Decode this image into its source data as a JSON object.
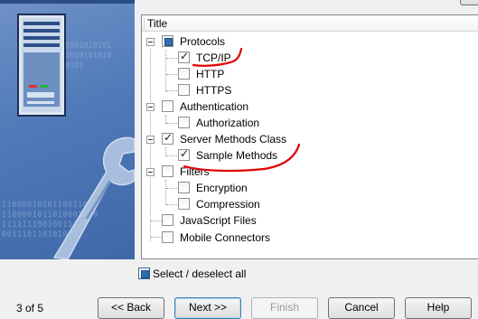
{
  "tree": {
    "header": "Title",
    "nodes": [
      {
        "label": "Protocols",
        "state": "partial"
      },
      {
        "label": "TCP/IP",
        "state": "checked"
      },
      {
        "label": "HTTP",
        "state": "unchecked"
      },
      {
        "label": "HTTPS",
        "state": "unchecked"
      },
      {
        "label": "Authentication",
        "state": "unchecked"
      },
      {
        "label": "Authorization",
        "state": "unchecked"
      },
      {
        "label": "Server Methods Class",
        "state": "checked"
      },
      {
        "label": "Sample Methods",
        "state": "checked"
      },
      {
        "label": "Filters",
        "state": "unchecked"
      },
      {
        "label": "Encryption",
        "state": "unchecked"
      },
      {
        "label": "Compression",
        "state": "unchecked"
      },
      {
        "label": "JavaScript Files",
        "state": "unchecked"
      },
      {
        "label": "Mobile Connectors",
        "state": "unchecked"
      }
    ]
  },
  "select_all": {
    "label": "Select / deselect all",
    "state": "partial"
  },
  "footer": {
    "step": "3 of 5",
    "back": "<< Back",
    "next": "Next >>",
    "finish": "Finish",
    "cancel": "Cancel",
    "help": "Help"
  },
  "banner": {
    "binary_lines": [
      "11000010101100110",
      "1100001011010001100",
      "1111111001001111",
      "001110110101001"
    ],
    "binary_top_lines": [
      "0101010101",
      "1010101010",
      "0101"
    ]
  },
  "annotation_color": "#e00000",
  "accent": "#2c6fb0"
}
